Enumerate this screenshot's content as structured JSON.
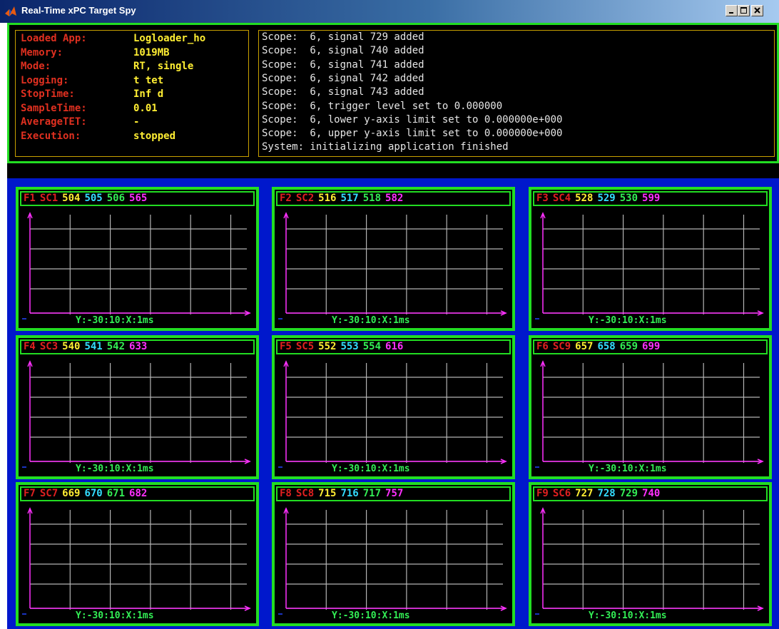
{
  "window": {
    "title": "Real-Time xPC Target Spy",
    "icon": "matlab-icon",
    "controls": [
      "minimize-icon",
      "maximize-icon",
      "close-icon"
    ]
  },
  "status": {
    "rows": [
      {
        "label": "Loaded App:",
        "value": "Logloader_ho"
      },
      {
        "label": "Memory:",
        "value": "1019MB"
      },
      {
        "label": "Mode:",
        "value": "RT, single"
      },
      {
        "label": "Logging:",
        "value": "t tet"
      },
      {
        "label": "StopTime:",
        "value": "Inf d"
      },
      {
        "label": "SampleTime:",
        "value": "0.01"
      },
      {
        "label": "AverageTET:",
        "value": "-"
      },
      {
        "label": "Execution:",
        "value": "stopped"
      }
    ]
  },
  "log": {
    "lines": [
      "Scope:  6, signal 729 added",
      "Scope:  6, signal 740 added",
      "Scope:  6, signal 741 added",
      "Scope:  6, signal 742 added",
      "Scope:  6, signal 743 added",
      "Scope:  6, trigger level set to 0.000000",
      "Scope:  6, lower y-axis limit set to 0.000000e+000",
      "Scope:  6, upper y-axis limit set to 0.000000e+000",
      "System: initializing application finished"
    ]
  },
  "scopes": [
    {
      "f": "F1",
      "sc": "SC1",
      "signals": [
        "504",
        "505",
        "506",
        "565"
      ],
      "scale": "Y:-30:10:X:1ms"
    },
    {
      "f": "F2",
      "sc": "SC2",
      "signals": [
        "516",
        "517",
        "518",
        "582"
      ],
      "scale": "Y:-30:10:X:1ms"
    },
    {
      "f": "F3",
      "sc": "SC4",
      "signals": [
        "528",
        "529",
        "530",
        "599"
      ],
      "scale": "Y:-30:10:X:1ms"
    },
    {
      "f": "F4",
      "sc": "SC3",
      "signals": [
        "540",
        "541",
        "542",
        "633"
      ],
      "scale": "Y:-30:10:X:1ms"
    },
    {
      "f": "F5",
      "sc": "SC5",
      "signals": [
        "552",
        "553",
        "554",
        "616"
      ],
      "scale": "Y:-30:10:X:1ms"
    },
    {
      "f": "F6",
      "sc": "SC9",
      "signals": [
        "657",
        "658",
        "659",
        "699"
      ],
      "scale": "Y:-30:10:X:1ms"
    },
    {
      "f": "F7",
      "sc": "SC7",
      "signals": [
        "669",
        "670",
        "671",
        "682"
      ],
      "scale": "Y:-30:10:X:1ms"
    },
    {
      "f": "F8",
      "sc": "SC8",
      "signals": [
        "715",
        "716",
        "717",
        "757"
      ],
      "scale": "Y:-30:10:X:1ms"
    },
    {
      "f": "F9",
      "sc": "SC6",
      "signals": [
        "727",
        "728",
        "729",
        "740"
      ],
      "scale": "Y:-30:10:X:1ms"
    }
  ],
  "colors": {
    "frame_green": "#22dd22",
    "scope_background": "#0018cc",
    "label_red": "#e02020",
    "value_yellow": "#ffee33",
    "signal_colors": [
      "#ffee33",
      "#33ddff",
      "#33ee55",
      "#ff30ff"
    ],
    "axis_magenta": "#ff30ff",
    "grid_gray": "#b4b4b4"
  }
}
